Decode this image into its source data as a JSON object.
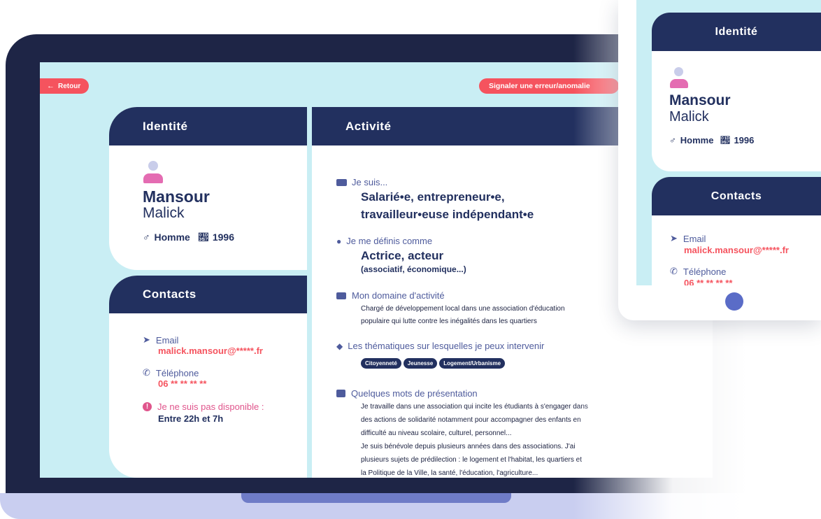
{
  "header": {
    "back_label": "Retour",
    "report_label": "Signaler une erreur/anomalie"
  },
  "identity": {
    "title": "Identité",
    "first_name": "Mansour",
    "last_name": "Malick",
    "gender": "Homme",
    "birth_year": "1996"
  },
  "contacts": {
    "title": "Contacts",
    "email_label": "Email",
    "email_value": "malick.mansour@*****.fr",
    "phone_label": "Téléphone",
    "phone_value": "06 ** ** ** **",
    "availability_label": "Je ne suis pas disponible :",
    "availability_value": "Entre 22h et 7h"
  },
  "activity": {
    "title": "Activité",
    "status_label": "Je suis...",
    "status_line1": "Salarié•e, entrepreneur•e,",
    "status_line2": "travailleur•euse indépendant•e",
    "define_label": "Je me définis comme",
    "define_value": "Actrice, acteur",
    "define_sub": "(associatif, économique...)",
    "domain_label": "Mon domaine d'activité",
    "domain_line1": "Chargé de développement local dans une association d'éducation",
    "domain_line2": "populaire qui lutte contre les inégalités dans les quartiers",
    "themes_label": "Les thématiques sur lesquelles je peux intervenir",
    "themes": [
      "Citoyenneté",
      "Jeunesse",
      "Logement/Urbanisme"
    ],
    "intro_label": "Quelques mots de présentation",
    "intro_lines": [
      "Je travaille dans une association qui incite les étudiants à s'engager dans",
      "des actions de solidarité notamment pour accompagner des enfants en",
      "difficulté au niveau scolaire, culturel, personnel...",
      "Je suis bénévole depuis plusieurs années dans des associations. J'ai",
      "plusieurs sujets de prédilection : le logement et l'habitat, les quartiers et",
      "la Politique de la Ville, la santé, l'éducation, l'agriculture..."
    ]
  },
  "mobile": {
    "identity_title": "Identité",
    "first_name": "Mansour",
    "last_name": "Malick",
    "gender": "Homme",
    "birth_year": "1996",
    "contacts_title": "Contacts",
    "email_label": "Email",
    "email_value": "malick.mansour@*****.fr",
    "phone_label": "Téléphone",
    "phone_value": "06 ** ** ** **"
  },
  "colors": {
    "navy": "#22305f",
    "accent_red": "#f5535e",
    "screen_bg": "#c9eef4",
    "bezel": "#1e2546"
  }
}
